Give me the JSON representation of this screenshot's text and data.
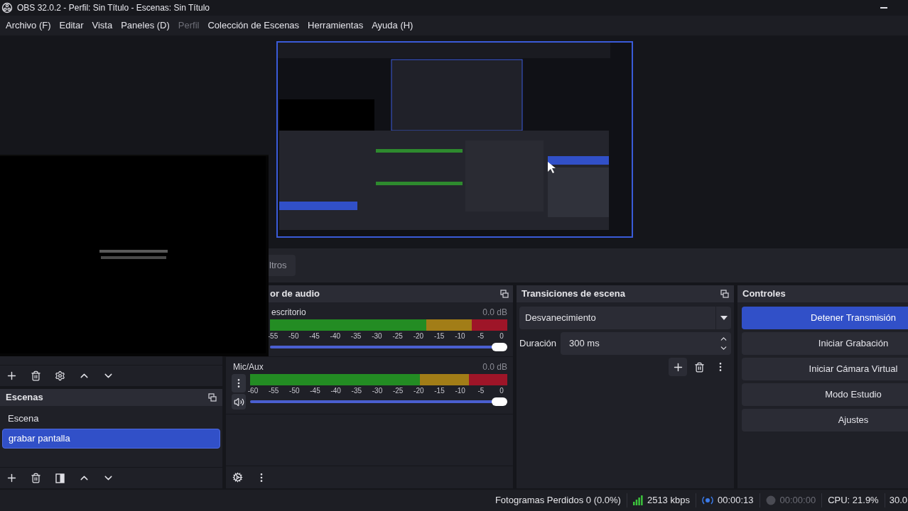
{
  "window": {
    "title": "OBS 32.0.2 - Perfil: Sin Título - Escenas: Sin Título"
  },
  "menu": [
    {
      "label": "Archivo (F)",
      "disabled": false
    },
    {
      "label": "Editar",
      "disabled": false
    },
    {
      "label": "Vista",
      "disabled": false
    },
    {
      "label": "Paneles (D)",
      "disabled": false
    },
    {
      "label": "Perfil",
      "disabled": true
    },
    {
      "label": "Colección de Escenas",
      "disabled": false
    },
    {
      "label": "Herramientas",
      "disabled": false
    },
    {
      "label": "Ayuda (H)",
      "disabled": false
    }
  ],
  "source_bar": {
    "buttons": [
      "ltros"
    ]
  },
  "scenes": {
    "title": "Escenas",
    "items": [
      {
        "label": "Escena",
        "selected": false
      },
      {
        "label": "grabar pantalla",
        "selected": true
      }
    ]
  },
  "mixer": {
    "title": "or de audio",
    "channels": [
      {
        "kind": "covered",
        "name": "escritorio",
        "reading": "0.0 dB",
        "meter": {
          "level": 1
        },
        "volume": {
          "level": 1
        },
        "scale": [
          "-55",
          "-50",
          "-45",
          "-40",
          "-35",
          "-30",
          "-25",
          "-20",
          "-15",
          "-10",
          "-5",
          "0"
        ]
      },
      {
        "kind": "full",
        "name": "Mic/Aux",
        "reading": "0.0 dB",
        "meter": {
          "level": 1
        },
        "volume": {
          "level": 1
        },
        "scale": [
          "-60",
          "-55",
          "-50",
          "-45",
          "-40",
          "-35",
          "-30",
          "-25",
          "-20",
          "-15",
          "-10",
          "-5",
          "0"
        ]
      }
    ]
  },
  "transitions": {
    "title": "Transiciones de escena",
    "select": {
      "value": "Desvanecimiento"
    },
    "duration": {
      "label": "Duración",
      "value": "300 ms"
    }
  },
  "controls": {
    "title": "Controles",
    "buttons": [
      {
        "label": "Detener Transmisión",
        "active": true
      },
      {
        "label": "Iniciar Grabación",
        "active": false
      },
      {
        "label": "Iniciar Cámara Virtual",
        "active": false
      },
      {
        "label": "Modo Estudio",
        "active": false
      },
      {
        "label": "Ajustes",
        "active": false
      }
    ]
  },
  "status_bar": {
    "dropped_frames": "Fotogramas Perdidos 0 (0.0%)",
    "bitrate": "2513 kbps",
    "stream_time": "00:00:13",
    "streaming": true,
    "record_time": "00:00:00",
    "recording": false,
    "cpu": "CPU: 21.9%",
    "fps": "30.0"
  }
}
